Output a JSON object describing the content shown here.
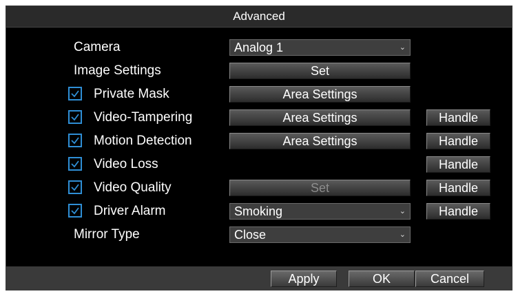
{
  "title": "Advanced",
  "rows": {
    "camera": {
      "label": "Camera",
      "value": "Analog 1"
    },
    "image_settings": {
      "label": "Image Settings",
      "button": "Set"
    },
    "private_mask": {
      "label": "Private Mask",
      "checked": true,
      "button": "Area Settings"
    },
    "video_tampering": {
      "label": "Video-Tampering",
      "checked": true,
      "button": "Area Settings",
      "handle": "Handle"
    },
    "motion_detection": {
      "label": "Motion Detection",
      "checked": true,
      "button": "Area Settings",
      "handle": "Handle"
    },
    "video_loss": {
      "label": "Video Loss",
      "checked": true,
      "handle": "Handle"
    },
    "video_quality": {
      "label": "Video Quality",
      "checked": true,
      "button": "Set",
      "button_disabled": true,
      "handle": "Handle"
    },
    "driver_alarm": {
      "label": "Driver Alarm",
      "checked": true,
      "value": "Smoking",
      "handle": "Handle"
    },
    "mirror_type": {
      "label": "Mirror Type",
      "value": "Close"
    }
  },
  "footer": {
    "apply": "Apply",
    "ok": "OK",
    "cancel": "Cancel"
  },
  "icons": {
    "check": "checkmark-icon",
    "dropdown": "chevron-down-icon"
  },
  "colors": {
    "accent": "#2f8fd6",
    "background": "#000000",
    "titlebar": "#2a2a2a",
    "footer": "#3a3a3a"
  }
}
